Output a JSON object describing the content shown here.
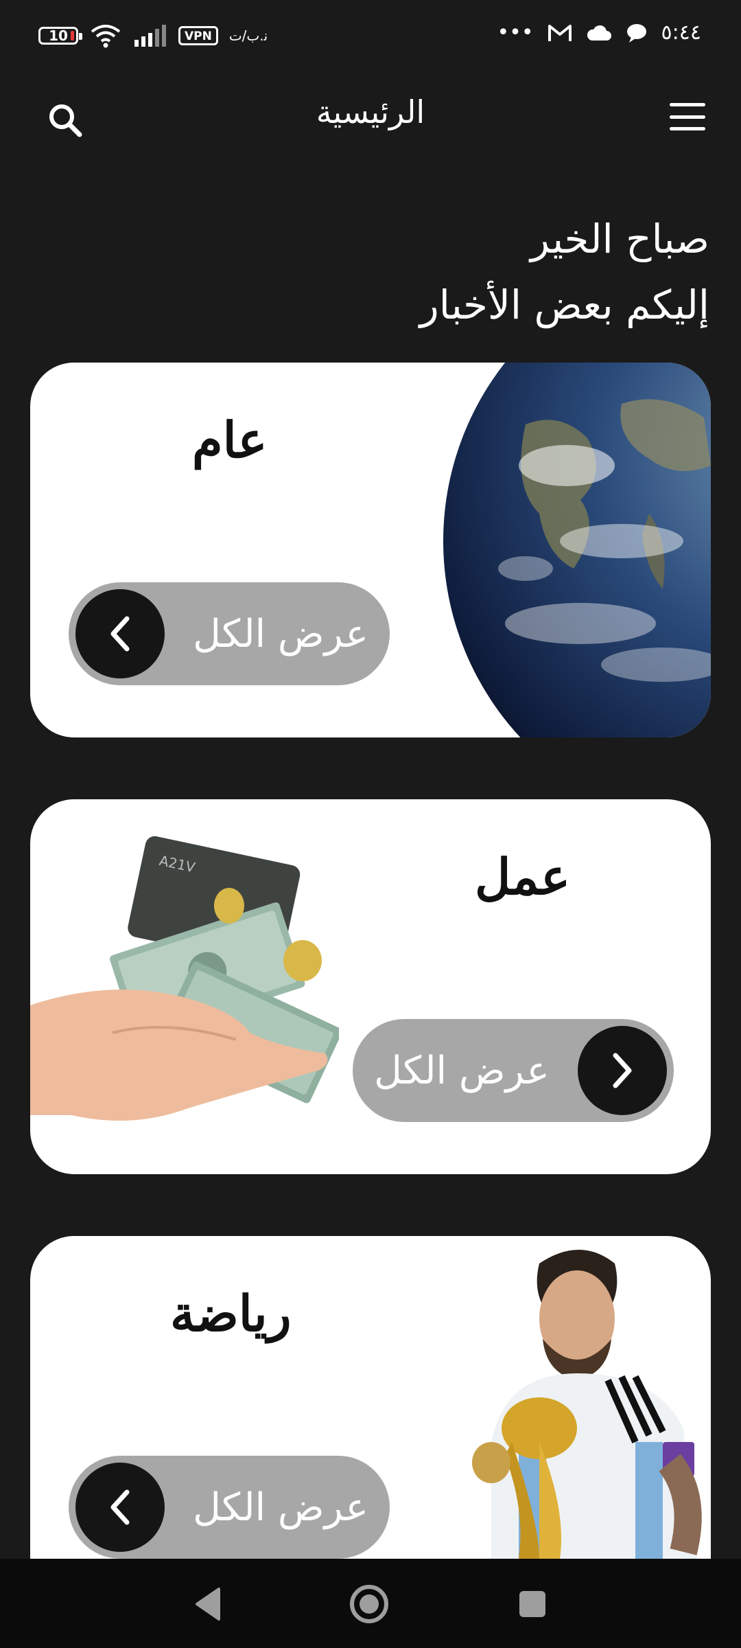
{
  "status_bar": {
    "battery_level": "10",
    "vpn_label": "VPN",
    "carrier_text": "ﻧ.ﺏ/ﺕ",
    "time": "٥:٤٤",
    "more_dots": "•••"
  },
  "header": {
    "title": "الرئيسية",
    "icons": {
      "menu": "hamburger-menu-icon",
      "search": "search-icon"
    }
  },
  "greeting": {
    "line1": "صباح الخير",
    "line2": "إليكم بعض الأخبار"
  },
  "categories": [
    {
      "title": "عام",
      "button_label": "عرض الكل",
      "image": "earth-globe"
    },
    {
      "title": "عمل",
      "button_label": "عرض الكل",
      "image": "hand-with-money"
    },
    {
      "title": "رياضة",
      "button_label": "عرض الكل",
      "image": "player-with-trophy"
    }
  ],
  "colors": {
    "background": "#1a1a1b",
    "card": "#ffffff",
    "pill": "#a7a7a7",
    "arrow_circle": "#151515",
    "nav_bar": "#0b0b0b"
  }
}
